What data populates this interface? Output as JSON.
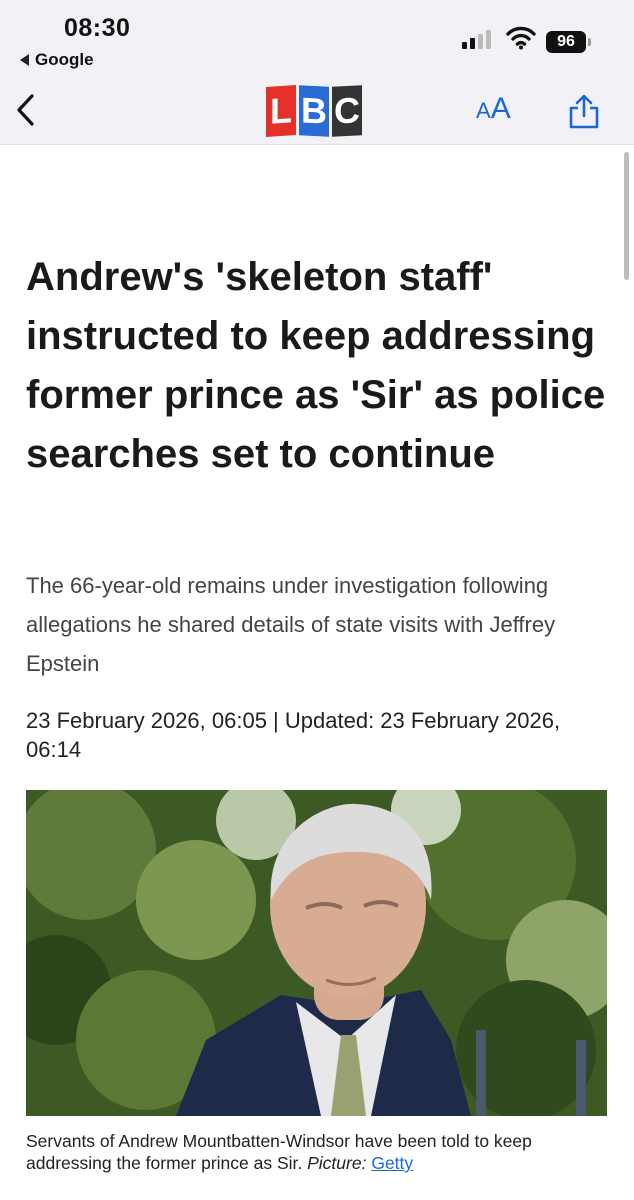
{
  "status_bar": {
    "time": "08:30",
    "back_app": "Google",
    "battery": "96"
  },
  "toolbar": {
    "logo_letters": [
      "L",
      "B",
      "C"
    ],
    "text_size_small": "A",
    "text_size_large": "A"
  },
  "article": {
    "headline": "Andrew's 'skeleton staff' instructed to keep addressing former prince as 'Sir' as police searches set to continue",
    "standfirst": "The 66-year-old remains under investigation following allegations he shared details of state visits with Jeffrey Epstein",
    "dateline": "23 February 2026, 06:05 | Updated: 23 February 2026, 06:14",
    "caption_text": "Servants of Andrew Mountbatten-Windsor have been told to keep addressing the former prince as Sir.",
    "caption_credit_label": "Picture:",
    "caption_credit_link": "Getty"
  },
  "colors": {
    "accent": "#1a68d6",
    "logo_red": "#e4322b",
    "logo_blue": "#2a6bd6",
    "logo_dark": "#333333"
  }
}
